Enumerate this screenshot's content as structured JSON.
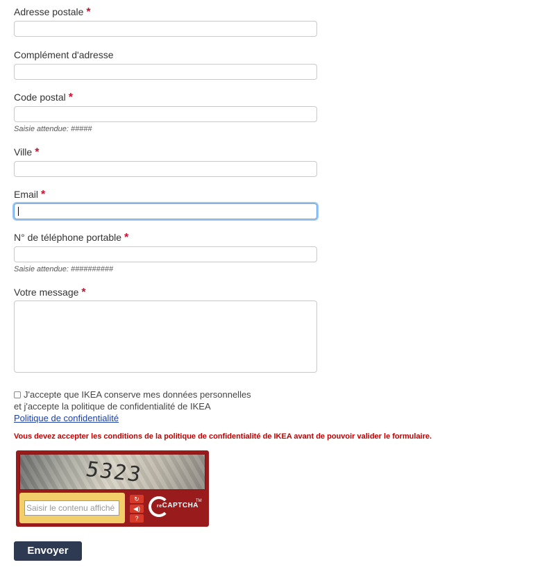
{
  "fields": [
    {
      "label": "Adresse postale",
      "required": "*"
    },
    {
      "label": "Complément d'adresse",
      "required": ""
    },
    {
      "label": "Code postal",
      "required": "*",
      "hint": "Saisie attendue: #####"
    },
    {
      "label": "Ville",
      "required": "*"
    },
    {
      "label": "Email",
      "required": "*"
    },
    {
      "label": "N° de téléphone portable",
      "required": "*",
      "hint": "Saisie attendue: ##########"
    },
    {
      "label": "Votre message",
      "required": "*"
    }
  ],
  "consent": {
    "line1": "J'accepte que IKEA conserve mes données personnelles",
    "line2": "et j'accepte la politique de confidentialité de IKEA",
    "link": "Politique de confidentialité"
  },
  "error": "Vous devez accepter les conditions de la politique de confidentialité de IKEA avant de pouvoir valider le formulaire.",
  "captcha": {
    "image_text": "5323",
    "placeholder": "Saisir le contenu affiché",
    "logo_prefix": "re",
    "logo_text": "CAPTCHA",
    "logo_tm": "TM",
    "refresh_icon": "refresh-icon",
    "audio_icon": "audio-icon",
    "help_icon": "help-icon"
  },
  "submit": "Envoyer",
  "colors": {
    "required": "#c8102e",
    "error": "#c00000",
    "button": "#2d3a52",
    "captcha": "#9a1b1b"
  }
}
